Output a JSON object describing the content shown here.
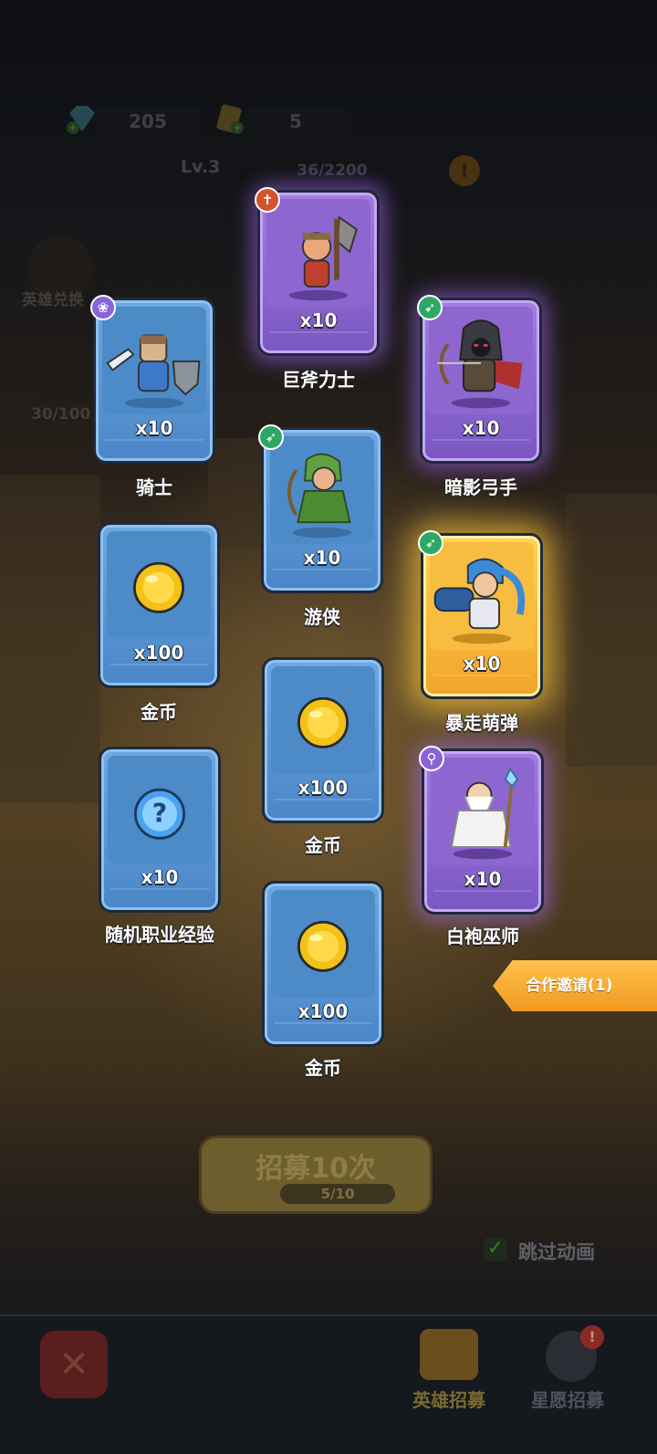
{
  "resources": {
    "gems": "205",
    "tickets": "5"
  },
  "level": {
    "label": "Lv.3",
    "progress_text": "36/2200",
    "alert": "!"
  },
  "side": {
    "hero_exchange": "英雄兑换",
    "star_progress": "30/100"
  },
  "cards": [
    {
      "name": "巨斧力士",
      "qty": "x10",
      "rarity": "purple",
      "badge": "axe-icon",
      "badge_glyph": "✝"
    },
    {
      "name": "骑士",
      "qty": "x10",
      "rarity": "blue",
      "badge": "paw-icon",
      "badge_glyph": "❀"
    },
    {
      "name": "暗影弓手",
      "qty": "x10",
      "rarity": "purple",
      "badge": "bow-icon",
      "badge_glyph": "➶"
    },
    {
      "name": "游侠",
      "qty": "x10",
      "rarity": "blue",
      "badge": "bow-icon",
      "badge_glyph": "➶"
    },
    {
      "name": "金币",
      "qty": "x100",
      "rarity": "blue",
      "badge": "",
      "badge_glyph": ""
    },
    {
      "name": "暴走萌弹",
      "qty": "x10",
      "rarity": "gold",
      "badge": "bow-icon",
      "badge_glyph": "➶"
    },
    {
      "name": "金币",
      "qty": "x100",
      "rarity": "blue",
      "badge": "",
      "badge_glyph": ""
    },
    {
      "name": "随机职业经验",
      "qty": "x10",
      "rarity": "blue",
      "badge": "",
      "badge_glyph": "?"
    },
    {
      "name": "白袍巫师",
      "qty": "x10",
      "rarity": "purple",
      "badge": "wand-icon",
      "badge_glyph": "⚲"
    },
    {
      "name": "金币",
      "qty": "x100",
      "rarity": "blue",
      "badge": "",
      "badge_glyph": ""
    }
  ],
  "invite": {
    "label": "合作邀请(1)"
  },
  "recruit": {
    "label": "招募10次",
    "progress": "5/10"
  },
  "skip": {
    "label": "跳过动画",
    "checked": true
  },
  "tabs": {
    "hero_recruit": "英雄招募",
    "wish_recruit": "星愿招募",
    "badge": "!"
  },
  "colors": {
    "purple_glow": "#a66eff",
    "gold_glow": "#ffc83c",
    "blue_card": "#4a86c7",
    "invite": "#f09a1f"
  }
}
